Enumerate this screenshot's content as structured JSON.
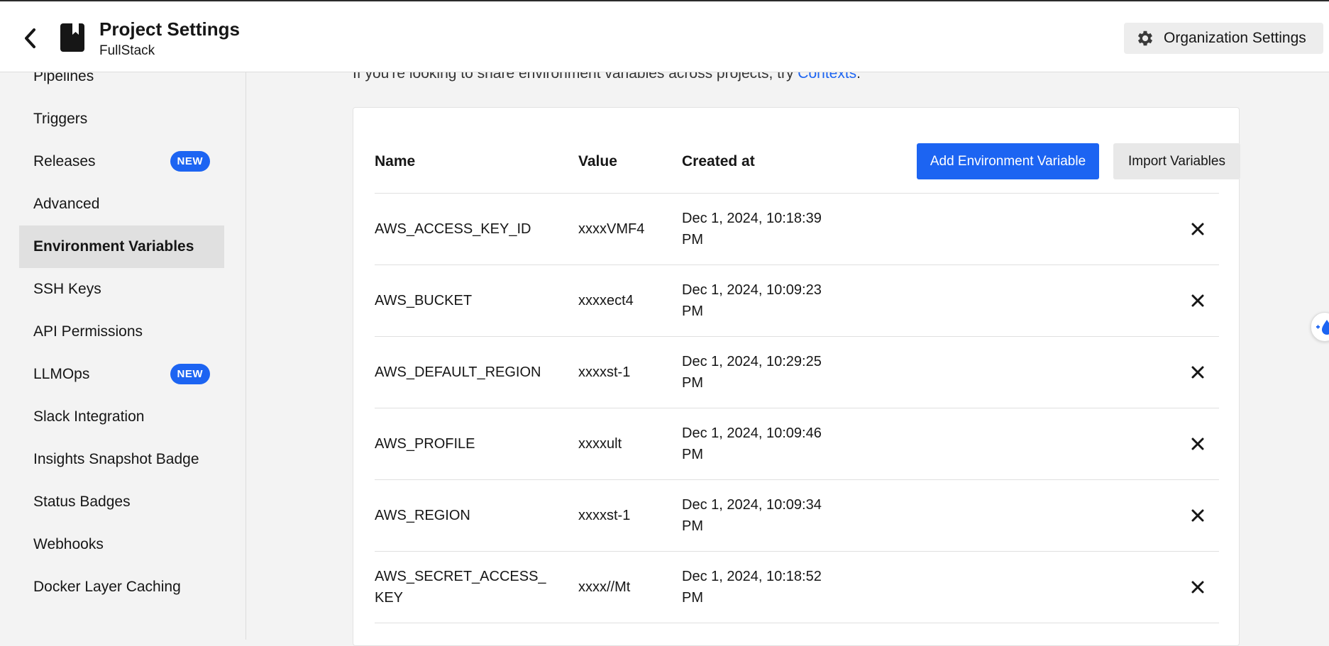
{
  "header": {
    "title": "Project Settings",
    "subtitle": "FullStack",
    "org_settings_label": "Organization Settings"
  },
  "sidebar": {
    "items": [
      {
        "label": "Pipelines"
      },
      {
        "label": "Triggers"
      },
      {
        "label": "Releases",
        "badge": "NEW"
      },
      {
        "label": "Advanced"
      },
      {
        "label": "Environment Variables",
        "active": true
      },
      {
        "label": "SSH Keys"
      },
      {
        "label": "API Permissions"
      },
      {
        "label": "LLMOps",
        "badge": "NEW"
      },
      {
        "label": "Slack Integration"
      },
      {
        "label": "Insights Snapshot Badge"
      },
      {
        "label": "Status Badges"
      },
      {
        "label": "Webhooks"
      },
      {
        "label": "Docker Layer Caching"
      }
    ]
  },
  "main": {
    "intro_text": "If you're looking to share environment variables across projects, try ",
    "intro_link": "Contexts",
    "intro_end": ".",
    "table": {
      "columns": [
        "Name",
        "Value",
        "Created at"
      ],
      "add_button": "Add Environment Variable",
      "import_button": "Import Variables",
      "rows": [
        {
          "name": "AWS_ACCESS_KEY_ID",
          "value": "xxxxVMF4",
          "created": "Dec 1, 2024, 10:18:39 PM"
        },
        {
          "name": "AWS_BUCKET",
          "value": "xxxxect4",
          "created": "Dec 1, 2024, 10:09:23 PM"
        },
        {
          "name": "AWS_DEFAULT_REGION",
          "value": "xxxxst-1",
          "created": "Dec 1, 2024, 10:29:25 PM"
        },
        {
          "name": "AWS_PROFILE",
          "value": "xxxxult",
          "created": "Dec 1, 2024, 10:09:46 PM"
        },
        {
          "name": "AWS_REGION",
          "value": "xxxxst-1",
          "created": "Dec 1, 2024, 10:09:34 PM"
        },
        {
          "name": "AWS_SECRET_ACCESS_KEY",
          "value": "xxxx//Mt",
          "created": "Dec 1, 2024, 10:18:52 PM"
        }
      ]
    }
  },
  "colors": {
    "accent": "#1c64f2",
    "background": "#f3f3f3",
    "active_item": "#e0e0e0"
  },
  "icons": {
    "back": "chevron-left-icon",
    "project": "bookmark-book-icon",
    "org": "gear-icon",
    "delete": "close-icon"
  }
}
